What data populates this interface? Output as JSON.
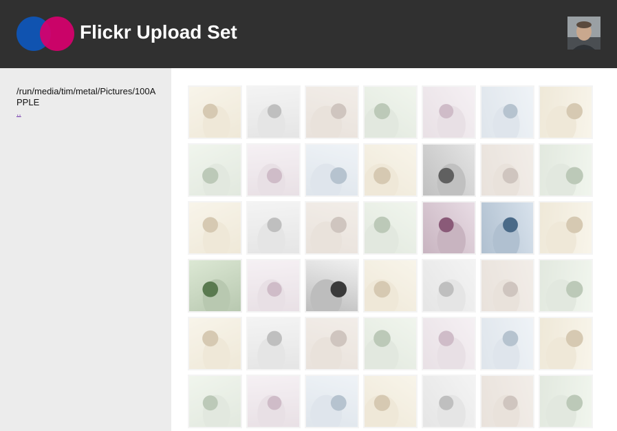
{
  "header": {
    "title": "Flickr Upload Set",
    "logo_colors": {
      "left": "#1053b0",
      "right": "#d6006d"
    }
  },
  "sidebar": {
    "path": "/run/media/tim/metal/Pictures/100APPLE",
    "parent_link": ".."
  },
  "grid": {
    "columns": 7,
    "rows": 6,
    "highlighted": [
      {
        "row": 2,
        "col": 5
      },
      {
        "row": 3,
        "col": 5
      },
      {
        "row": 3,
        "col": 6
      },
      {
        "row": 4,
        "col": 1
      },
      {
        "row": 4,
        "col": 3
      }
    ]
  },
  "colors": {
    "header_bg": "#303030",
    "sidebar_bg": "#ececec",
    "link": "#6a2aa8"
  }
}
